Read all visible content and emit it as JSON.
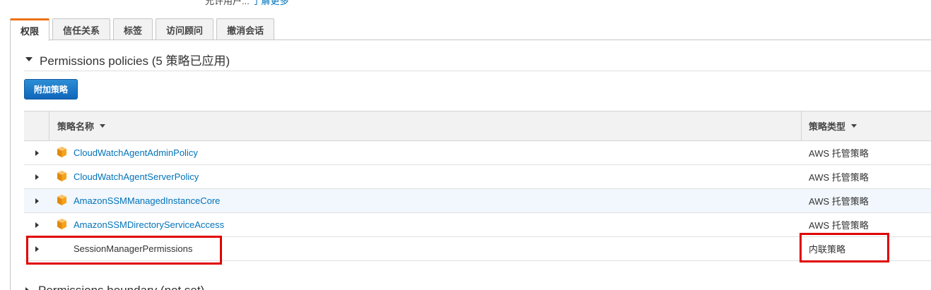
{
  "top_clipped": {
    "text": "允许用户...",
    "link": "了解更多"
  },
  "tabs": [
    {
      "label": "权限",
      "active": true
    },
    {
      "label": "信任关系",
      "active": false
    },
    {
      "label": "标签",
      "active": false
    },
    {
      "label": "访问顾问",
      "active": false
    },
    {
      "label": "撤消会话",
      "active": false
    }
  ],
  "section": {
    "title": "Permissions policies (5 策略已应用)",
    "attach_button": "附加策略"
  },
  "table": {
    "columns": {
      "name": "策略名称",
      "type": "策略类型"
    },
    "rows": [
      {
        "name": "CloudWatchAgentAdminPolicy",
        "type": "AWS 托管策略",
        "icon": "aws-managed-policy-icon",
        "link": true
      },
      {
        "name": "CloudWatchAgentServerPolicy",
        "type": "AWS 托管策略",
        "icon": "aws-managed-policy-icon",
        "link": true
      },
      {
        "name": "AmazonSSMManagedInstanceCore",
        "type": "AWS 托管策略",
        "icon": "aws-managed-policy-icon",
        "link": true
      },
      {
        "name": "AmazonSSMDirectoryServiceAccess",
        "type": "AWS 托管策略",
        "icon": "aws-managed-policy-icon",
        "link": true
      },
      {
        "name": "SessionManagerPermissions",
        "type": "内联策略",
        "icon": "",
        "link": false
      }
    ]
  },
  "next_section": {
    "title": "Permissions boundary (not set)"
  },
  "colors": {
    "link": "#0073bb",
    "button": "#1a73c4",
    "tab_accent": "#ec7211",
    "annotation": "#e00000",
    "aws_icon": "#f7a21b"
  }
}
